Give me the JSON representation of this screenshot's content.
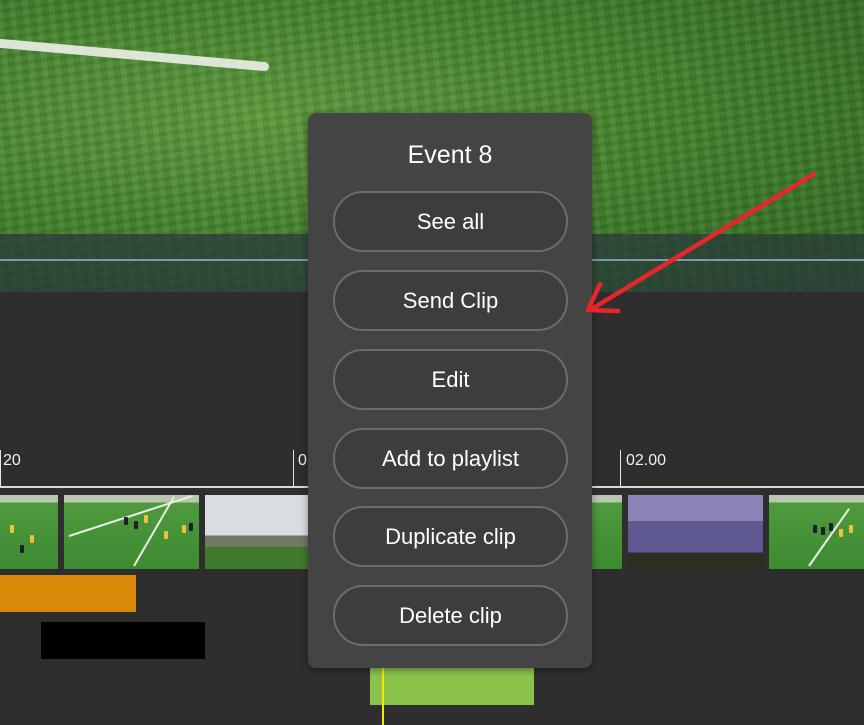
{
  "timeline": {
    "ticks": [
      "20",
      "0",
      "02.00"
    ]
  },
  "context_menu": {
    "title": "Event 8",
    "items": [
      "See all",
      "Send Clip",
      "Edit",
      "Add to playlist",
      "Duplicate clip",
      "Delete clip"
    ]
  },
  "colors": {
    "annotation_arrow": "#e8262a",
    "track_orange": "#d98808",
    "track_green": "#8bc34a",
    "playhead": "#f5e60e"
  }
}
